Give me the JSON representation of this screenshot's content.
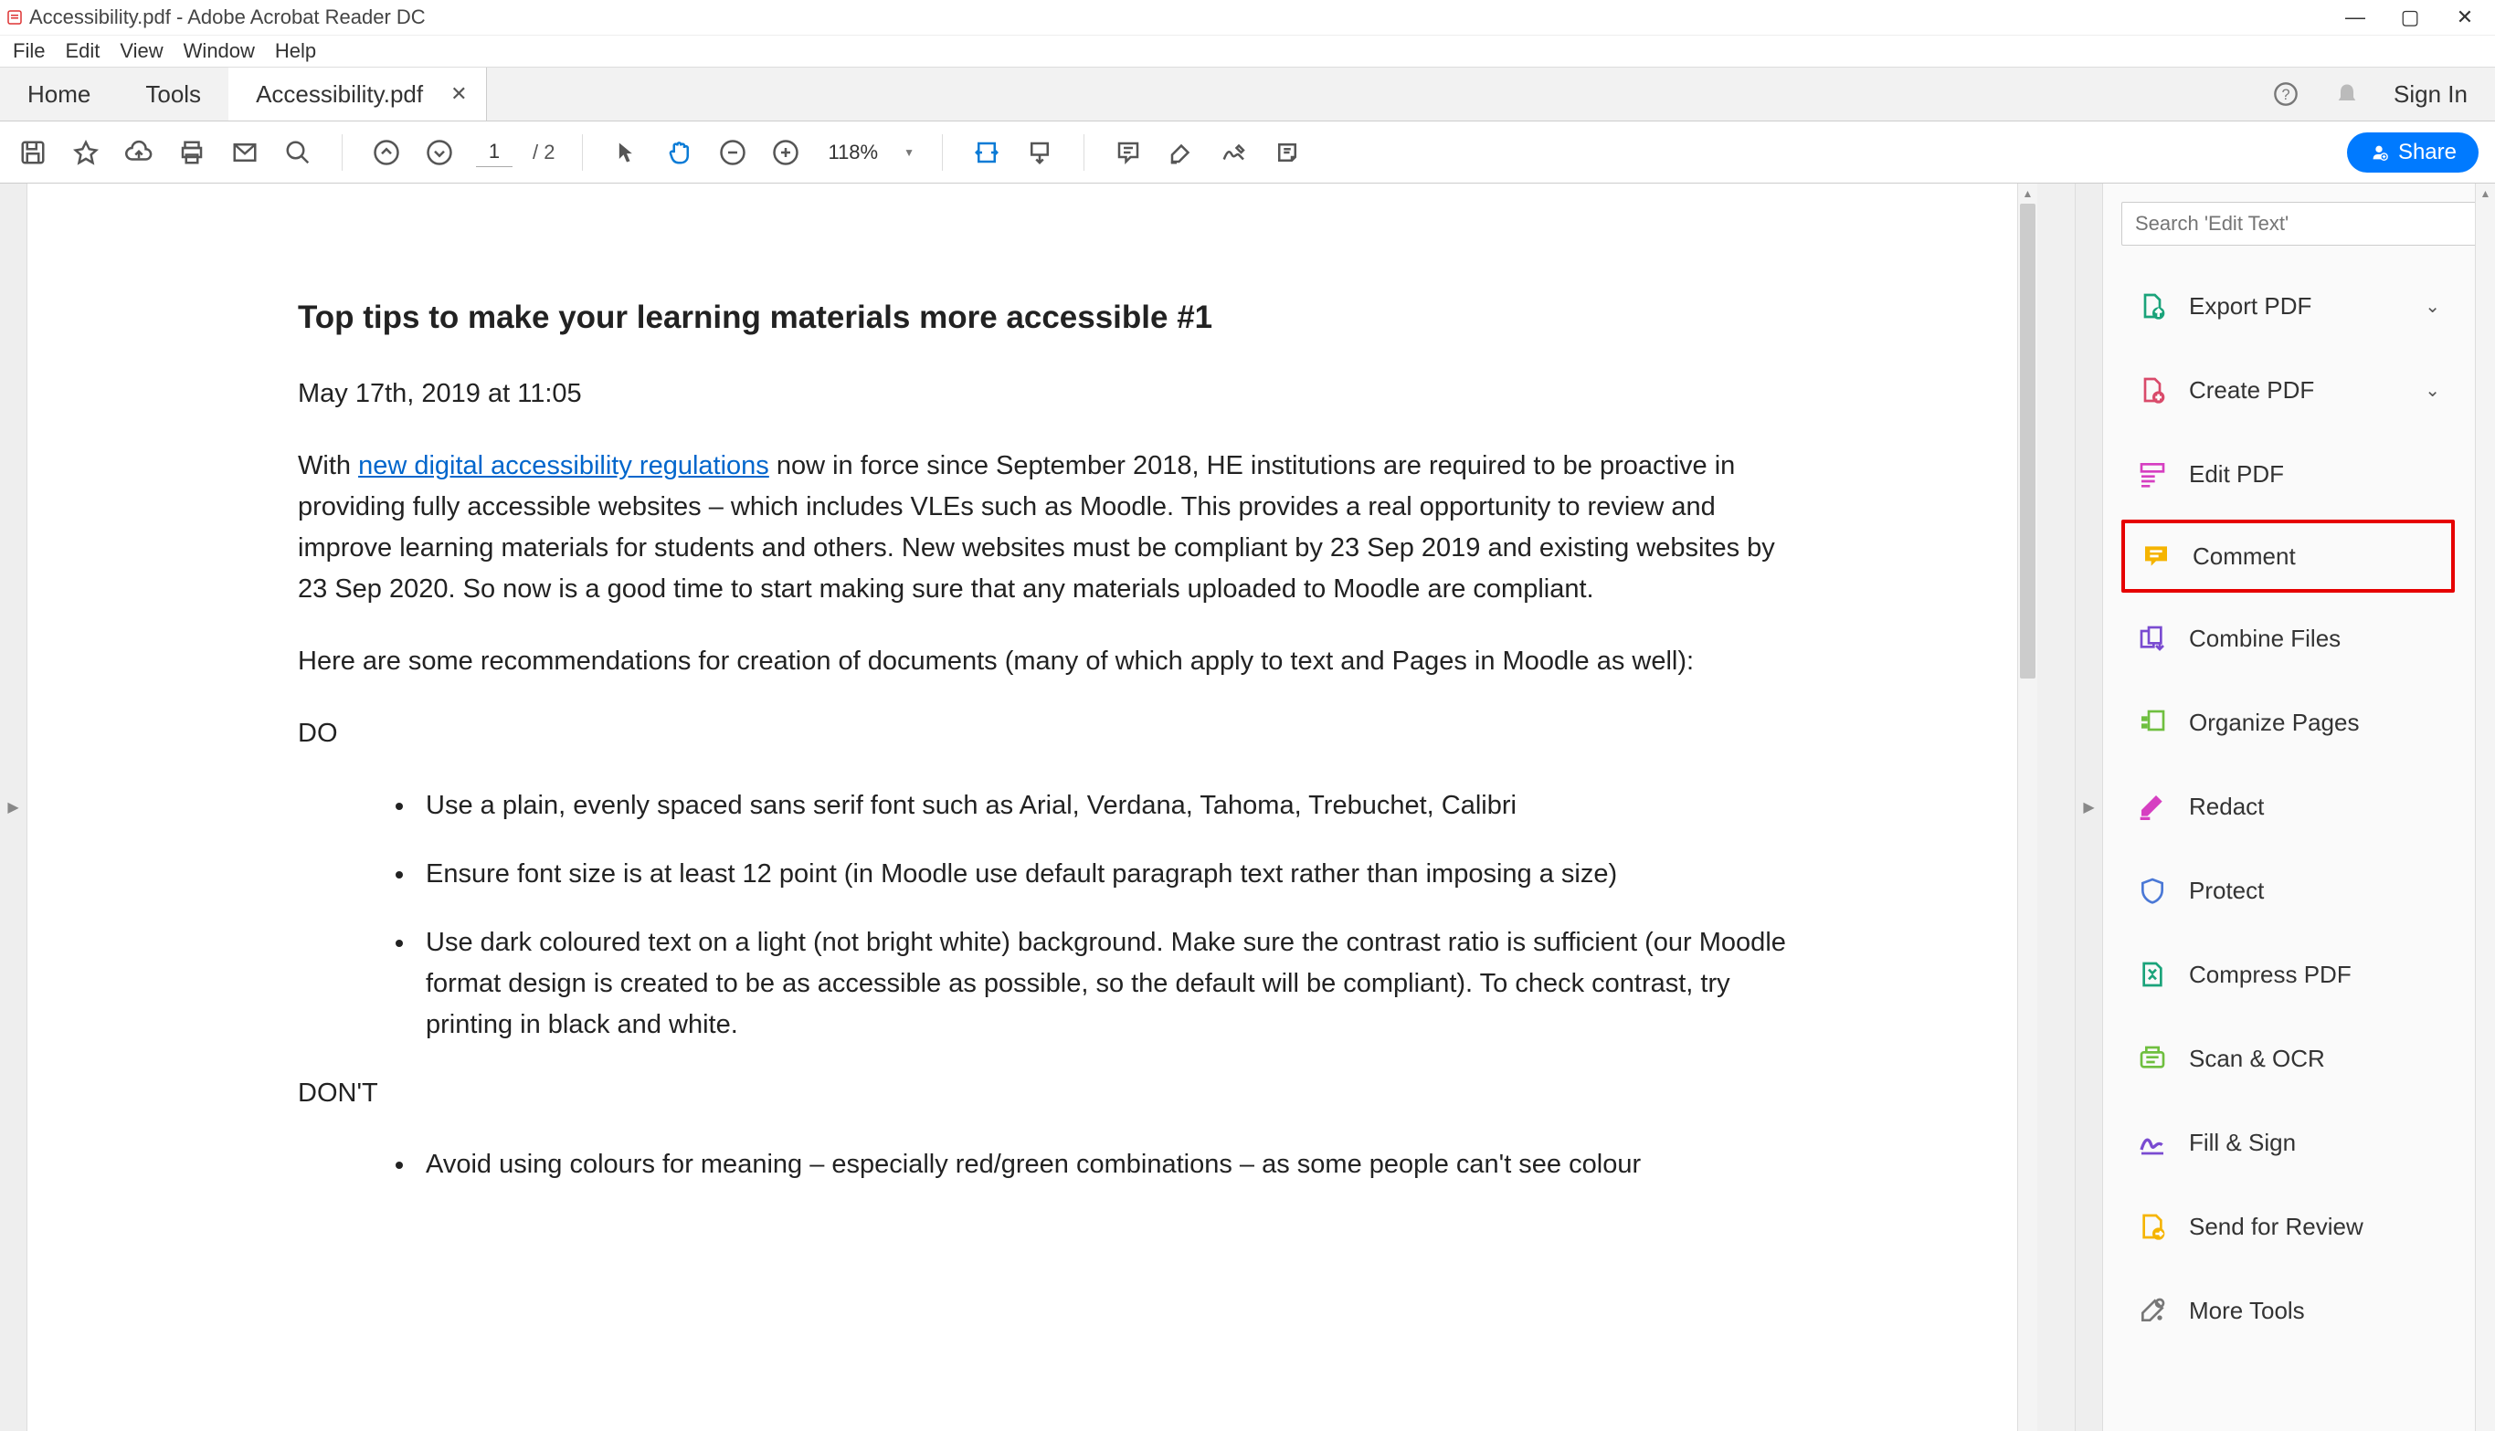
{
  "window": {
    "title": "Accessibility.pdf - Adobe Acrobat Reader DC"
  },
  "menubar": {
    "items": [
      "File",
      "Edit",
      "View",
      "Window",
      "Help"
    ]
  },
  "tabs": {
    "home": "Home",
    "tools": "Tools",
    "doc": "Accessibility.pdf",
    "signin": "Sign In"
  },
  "toolbar": {
    "current_page": "1",
    "total_pages": "/ 2",
    "zoom": "118%",
    "share": "Share"
  },
  "right_panel": {
    "search_placeholder": "Search 'Edit Text'",
    "tools": [
      {
        "label": "Export PDF",
        "icon": "export",
        "color": "#1aa37a",
        "chev": true
      },
      {
        "label": "Create PDF",
        "icon": "create",
        "color": "#d94a6a",
        "chev": true
      },
      {
        "label": "Edit PDF",
        "icon": "edit",
        "color": "#d63fc1",
        "chev": false
      },
      {
        "label": "Comment",
        "icon": "comment",
        "color": "#f5b400",
        "chev": false,
        "highlight": true
      },
      {
        "label": "Combine Files",
        "icon": "combine",
        "color": "#7a4bd1",
        "chev": false
      },
      {
        "label": "Organize Pages",
        "icon": "organize",
        "color": "#6fbf3f",
        "chev": false
      },
      {
        "label": "Redact",
        "icon": "redact",
        "color": "#d63fc1",
        "chev": false
      },
      {
        "label": "Protect",
        "icon": "protect",
        "color": "#4a78d6",
        "chev": false
      },
      {
        "label": "Compress PDF",
        "icon": "compress",
        "color": "#1aa37a",
        "chev": false
      },
      {
        "label": "Scan & OCR",
        "icon": "scan",
        "color": "#6fbf3f",
        "chev": false
      },
      {
        "label": "Fill & Sign",
        "icon": "sign",
        "color": "#7a4bd1",
        "chev": false
      },
      {
        "label": "Send for Review",
        "icon": "review",
        "color": "#f5b400",
        "chev": false
      },
      {
        "label": "More Tools",
        "icon": "more",
        "color": "#777777",
        "chev": false
      }
    ]
  },
  "document": {
    "heading": "Top tips to make your learning materials more accessible #1",
    "date": "May 17th, 2019 at 11:05",
    "intro_pre": "With ",
    "intro_link": "new digital accessibility regulations",
    "intro_post": " now in force since September 2018, HE institutions are required to be proactive in providing fully accessible websites – which includes VLEs such as Moodle. This provides a real opportunity to review and improve learning materials for students and others. New websites must be compliant by 23 Sep 2019 and existing websites by 23 Sep 2020. So now is a good time to start making sure that any materials uploaded to Moodle are compliant.",
    "recs_intro": "Here are some recommendations for creation of documents (many of which apply to text and Pages in Moodle as well):",
    "do_label": "DO",
    "do_items": [
      "Use a plain, evenly spaced sans serif font such as Arial,  Verdana, Tahoma, Trebuchet, Calibri",
      "Ensure font size is at least 12 point (in Moodle use default paragraph text rather than imposing a size)",
      "Use dark coloured text on a light (not bright white) background. Make sure the contrast ratio is sufficient (our Moodle format design is created to be as accessible as possible, so the default will be compliant). To check contrast, try printing in black and white."
    ],
    "dont_label": "DON'T",
    "dont_items": [
      "Avoid using colours for meaning – especially red/green combinations – as some people can't see colour"
    ]
  }
}
